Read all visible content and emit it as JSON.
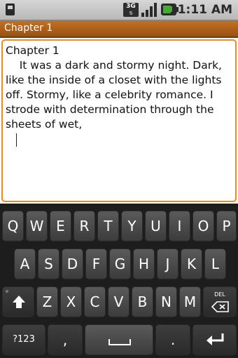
{
  "status_bar": {
    "network": "3G",
    "time": "11:11 AM",
    "icons": [
      "sd-card-icon",
      "network-3g-icon",
      "signal-icon",
      "battery-icon"
    ]
  },
  "app": {
    "title": "Chapter 1"
  },
  "editor": {
    "heading": "Chapter 1",
    "body": "    It was a dark and stormy night. Dark, like the inside of a closet with the lights off. Stormy, like a celebrity romance. I strode with determination through the sheets of wet,"
  },
  "keyboard": {
    "row1": [
      "Q",
      "W",
      "E",
      "R",
      "T",
      "Y",
      "U",
      "I",
      "O",
      "P"
    ],
    "row2": [
      "A",
      "S",
      "D",
      "F",
      "G",
      "H",
      "J",
      "K",
      "L"
    ],
    "row3": [
      "Z",
      "X",
      "C",
      "V",
      "B",
      "N",
      "M"
    ],
    "shift_icon": "shift-arrow-icon",
    "delete_label": "DEL",
    "symbols_label": "?123",
    "comma_label": ",",
    "space_icon": "space-bar-icon",
    "period_label": ".",
    "enter_icon": "enter-icon"
  },
  "colors": {
    "accent": "#f08a1e",
    "title_bar": "#b0621c"
  }
}
